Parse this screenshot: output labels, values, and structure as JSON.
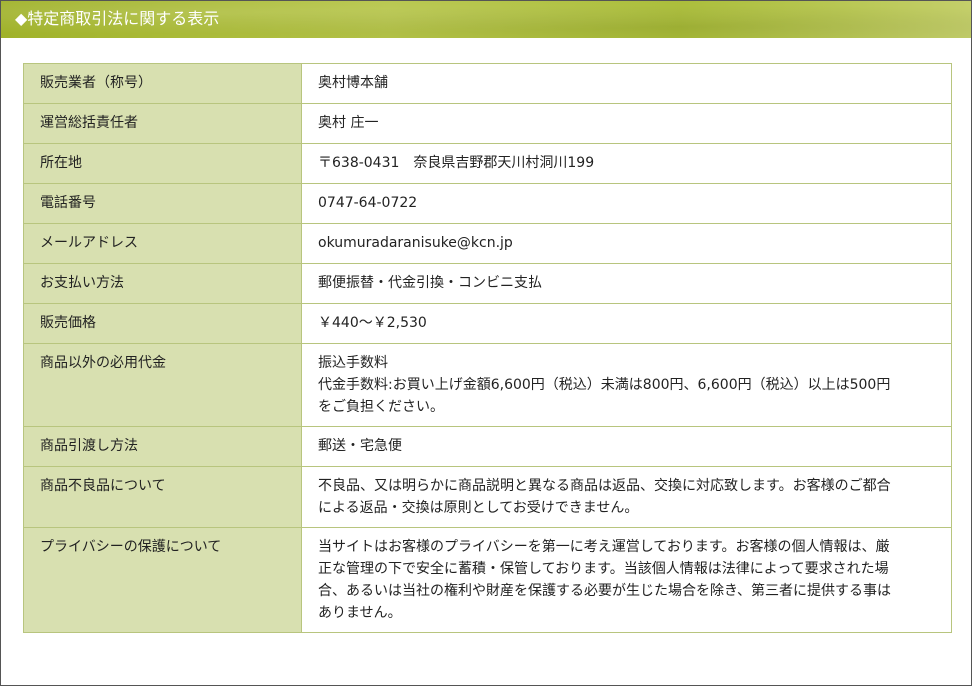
{
  "header": {
    "title": "◆特定商取引法に関する表示"
  },
  "table": {
    "rows": [
      {
        "label": "販売業者（称号）",
        "lines": [
          "奥村博本舗"
        ]
      },
      {
        "label": "運営総括責任者",
        "lines": [
          "奥村 庄一"
        ]
      },
      {
        "label": "所在地",
        "lines": [
          "〒638-0431　奈良県吉野郡天川村洞川199"
        ]
      },
      {
        "label": "電話番号",
        "lines": [
          "0747-64-0722"
        ]
      },
      {
        "label": "メールアドレス",
        "lines": [
          "okumuradaranisuke@kcn.jp"
        ]
      },
      {
        "label": "お支払い方法",
        "lines": [
          "郵便振替・代金引換・コンビニ支払"
        ]
      },
      {
        "label": "販売価格",
        "lines": [
          "￥440～￥2,530"
        ]
      },
      {
        "label": "商品以外の必用代金",
        "lines": [
          "振込手数料",
          "代金手数料:お買い上げ金額6,600円（税込）未満は800円、6,600円（税込）以上は500円",
          "をご負担ください。"
        ]
      },
      {
        "label": "商品引渡し方法",
        "lines": [
          "郵送・宅急便"
        ]
      },
      {
        "label": "商品不良品について",
        "lines": [
          "不良品、又は明らかに商品説明と異なる商品は返品、交換に対応致します。お客様のご都合",
          "による返品・交換は原則としてお受けできません。"
        ]
      },
      {
        "label": "プライバシーの保護について",
        "lines": [
          "当サイトはお客様のプライバシーを第一に考え運営しております。お客様の個人情報は、厳",
          "正な管理の下で安全に蓄積・保管しております。当該個人情報は法律によって要求された場",
          "合、あるいは当社の権利や財産を保護する必要が生じた場合を除き、第三者に提供する事は",
          "ありません。"
        ]
      }
    ]
  }
}
